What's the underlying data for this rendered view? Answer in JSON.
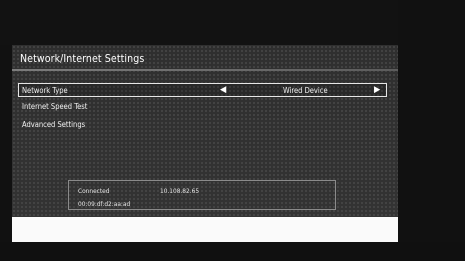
{
  "header": {
    "title": "Network/Internet Settings"
  },
  "menu": {
    "items": [
      {
        "label": "Network Type",
        "value": "Wired Device",
        "left_icon": "triangle-left-icon",
        "right_icon": "triangle-right-icon"
      },
      {
        "label": "Internet Speed Test"
      },
      {
        "label": "Advanced Settings"
      }
    ]
  },
  "status": {
    "state": "Connected",
    "ip": "10.108.82.65",
    "mac": "00:09:df:d2:aa:ad"
  },
  "colors": {
    "panel": "#3a3a3a",
    "text": "#ffffff",
    "frame": "#e6e6e6"
  }
}
